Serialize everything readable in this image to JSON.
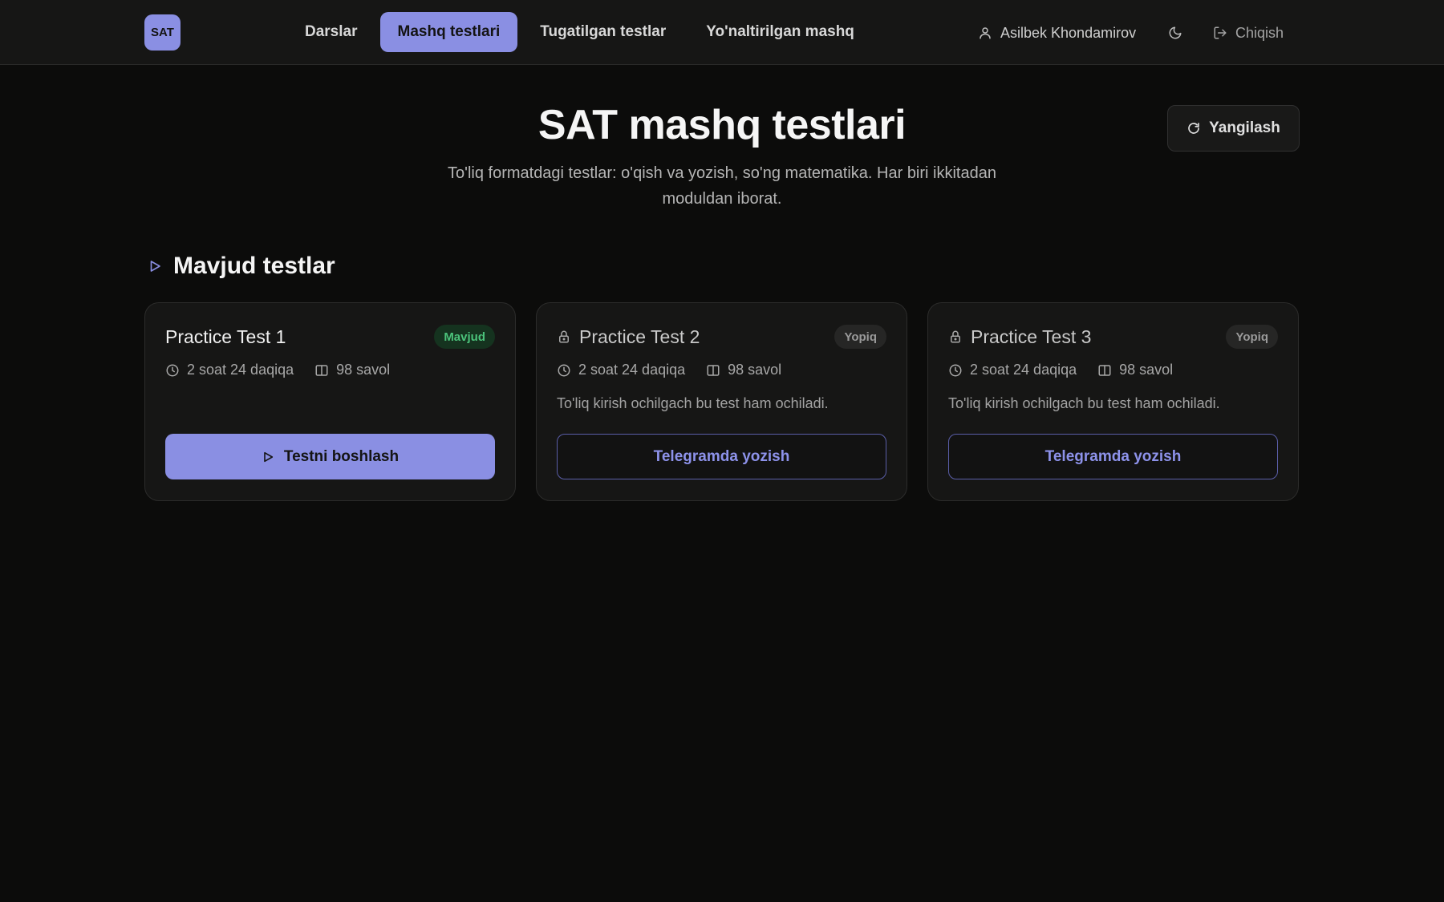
{
  "app": {
    "logo_text": "SAT"
  },
  "nav": {
    "items": [
      {
        "label": "Darslar"
      },
      {
        "label": "Mashq testlari"
      },
      {
        "label": "Tugatilgan testlar"
      },
      {
        "label": "Yo'naltirilgan mashq"
      }
    ],
    "active_index": 1,
    "user_name": "Asilbek Khondamirov",
    "logout_label": "Chiqish"
  },
  "header": {
    "title": "SAT mashq testlari",
    "subtitle": "To'liq formatdagi testlar: o'qish va yozish, so'ng matematika. Har biri ikkitadan moduldan iborat.",
    "refresh_label": "Yangilash"
  },
  "section": {
    "title": "Mavjud testlar"
  },
  "cards": [
    {
      "title": "Practice Test 1",
      "badge": "Mavjud",
      "duration": "2 soat 24 daqiqa",
      "questions": "98 savol",
      "note": "",
      "button": "Testni boshlash",
      "locked": false
    },
    {
      "title": "Practice Test 2",
      "badge": "Yopiq",
      "duration": "2 soat 24 daqiqa",
      "questions": "98 savol",
      "note": "To'liq kirish ochilgach bu test ham ochiladi.",
      "button": "Telegramda yozish",
      "locked": true
    },
    {
      "title": "Practice Test 3",
      "badge": "Yopiq",
      "duration": "2 soat 24 daqiqa",
      "questions": "98 savol",
      "note": "To'liq kirish ochilgach bu test ham ochiladi.",
      "button": "Telegramda yozish",
      "locked": true
    }
  ],
  "colors": {
    "accent": "#8a8fe3",
    "background": "#0c0c0b",
    "surface": "#161615",
    "success": "#4bc27a"
  }
}
